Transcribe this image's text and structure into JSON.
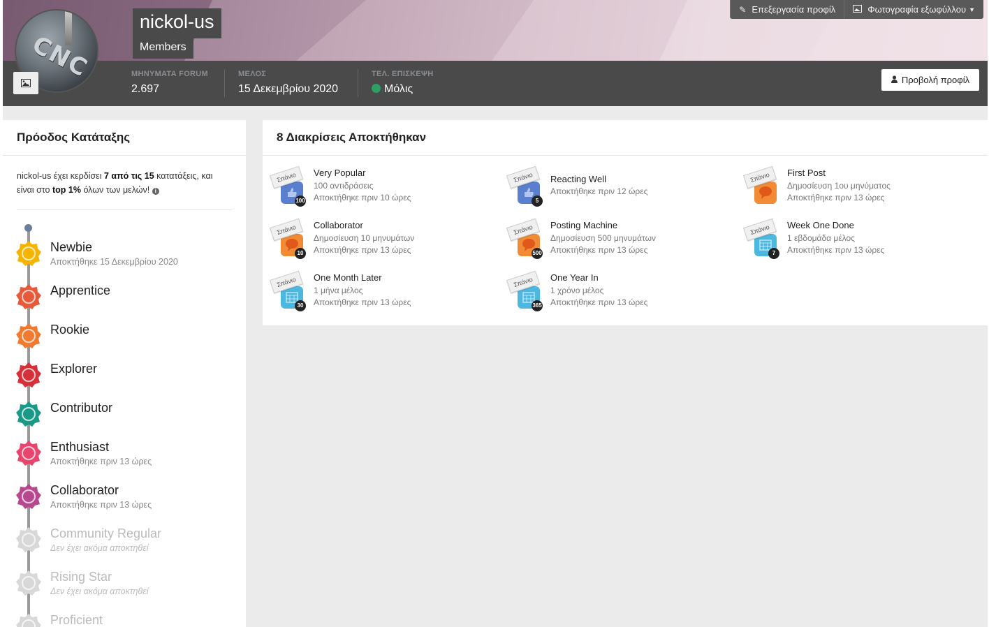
{
  "profile": {
    "username": "nickol-us",
    "group": "Members",
    "edit_profile_label": "Επεξεργασία προφίλ",
    "cover_photo_label": "Φωτογραφία εξωφύλλου",
    "view_profile_label": "Προβολή προφίλ",
    "avatar_text": "CNC"
  },
  "stats": [
    {
      "label": "ΜΗΝΥΜΑΤΑ FORUM",
      "value": "2.697"
    },
    {
      "label": "ΜΕΛΟΣ",
      "value": "15 Δεκεμβρίου 2020"
    },
    {
      "label": "ΤΕΛ. ΕΠΙΣΚΕΨΗ",
      "value": "Μόλις"
    }
  ],
  "rank_progress": {
    "title": "Πρόοδος Κατάταξης",
    "summary_user": "nickol-us",
    "summary_text1": " έχει κερδίσει ",
    "summary_bold1": "7 από τις 15",
    "summary_text2": " κατατάξεις, και είναι στο ",
    "summary_bold2": "top 1%",
    "summary_text3": " όλων των μελών!",
    "ranks": [
      {
        "name": "Newbie",
        "date": "Αποκτήθηκε 15 Δεκεμβρίου 2020",
        "color": "#f5b400",
        "icon": "pacifier-icon"
      },
      {
        "name": "Apprentice",
        "date": "",
        "color": "#e65a3a",
        "icon": "apprentice-icon"
      },
      {
        "name": "Rookie",
        "date": "",
        "color": "#f07a30",
        "icon": "rocking-horse-icon"
      },
      {
        "name": "Explorer",
        "date": "",
        "color": "#d6303a",
        "icon": "explorer-icon"
      },
      {
        "name": "Contributor",
        "date": "",
        "color": "#1a9a86",
        "icon": "leaf-icon"
      },
      {
        "name": "Enthusiast",
        "date": "Αποκτήθηκε πριν 13 ώρες",
        "color": "#e8466e",
        "icon": "lotus-icon"
      },
      {
        "name": "Collaborator",
        "date": "Αποκτήθηκε πριν 13 ώρες",
        "color": "#b8488e",
        "icon": "puzzle-icon"
      },
      {
        "name": "Community Regular",
        "date": "Δεν έχει ακόμα αποκτηθεί",
        "color": "#d8d8d8",
        "icon": "regular-icon"
      },
      {
        "name": "Rising Star",
        "date": "Δεν έχει ακόμα αποκτηθεί",
        "color": "#d8d8d8",
        "icon": "star-icon"
      },
      {
        "name": "Proficient",
        "date": "",
        "color": "#d8d8d8",
        "icon": "proficient-icon"
      }
    ]
  },
  "achievements": {
    "title": "8 Διακρίσεις Αποκτήθηκαν",
    "rare_label": "Σπάνιο",
    "items": [
      {
        "name": "Very Popular",
        "desc": "100 αντιδράσεις",
        "when": "Αποκτήθηκε πριν 10 ώρες",
        "count": "100",
        "color": "#5b7fcf",
        "icon": "thumbs-up-icon"
      },
      {
        "name": "Reacting Well",
        "desc": "",
        "when": "Αποκτήθηκε πριν 12 ώρες",
        "count": "5",
        "color": "#5b7fcf",
        "icon": "thumbs-up-icon"
      },
      {
        "name": "First Post",
        "desc": "Δημοσίευση 1ου μηνύματος",
        "when": "Αποκτήθηκε πριν 13 ώρες",
        "count": "",
        "color": "#f28b35",
        "icon": "speech-bubble-icon"
      },
      {
        "name": "Collaborator",
        "desc": "Δημοσίευση 10 μηνυμάτων",
        "when": "Αποκτήθηκε πριν 13 ώρες",
        "count": "10",
        "color": "#f28b35",
        "icon": "speech-bubble-icon"
      },
      {
        "name": "Posting Machine",
        "desc": "Δημοσίευση 500 μηνυμάτων",
        "when": "Αποκτήθηκε πριν 13 ώρες",
        "count": "500",
        "color": "#f28b35",
        "icon": "speech-bubble-icon"
      },
      {
        "name": "Week One Done",
        "desc": "1 εβδομάδα μέλος",
        "when": "Αποκτήθηκε πριν 13 ώρες",
        "count": "7",
        "color": "#4cb8e0",
        "icon": "calendar-icon"
      },
      {
        "name": "One Month Later",
        "desc": "1 μήνα μέλος",
        "when": "Αποκτήθηκε πριν 13 ώρες",
        "count": "30",
        "color": "#4cb8e0",
        "icon": "calendar-icon"
      },
      {
        "name": "One Year In",
        "desc": "1 χρόνο μέλος",
        "when": "Αποκτήθηκε πριν 13 ώρες",
        "count": "365",
        "color": "#4cb8e0",
        "icon": "calendar-icon"
      }
    ]
  }
}
